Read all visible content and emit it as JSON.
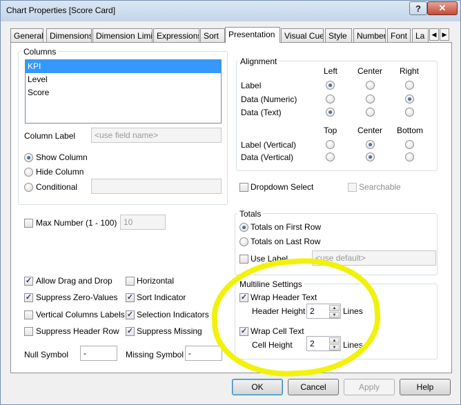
{
  "window": {
    "title": "Chart Properties [Score Card]",
    "help_button": "?",
    "close_button": "✕"
  },
  "tabs": [
    {
      "label": "General"
    },
    {
      "label": "Dimensions"
    },
    {
      "label": "Dimension Limits"
    },
    {
      "label": "Expressions"
    },
    {
      "label": "Sort"
    },
    {
      "label": "Presentation"
    },
    {
      "label": "Visual Cues"
    },
    {
      "label": "Style"
    },
    {
      "label": "Number"
    },
    {
      "label": "Font"
    },
    {
      "label": "La"
    }
  ],
  "active_tab": "Presentation",
  "columns": {
    "group_label": "Columns",
    "items": [
      {
        "label": "KPI",
        "selected": true
      },
      {
        "label": "Level",
        "selected": false
      },
      {
        "label": "Score",
        "selected": false
      }
    ],
    "column_label_text": "Column Label",
    "column_label_placeholder": "<use field name>",
    "show_column": "Show Column",
    "hide_column": "Hide Column",
    "conditional": "Conditional"
  },
  "alignment": {
    "group_label": "Alignment",
    "col_left": "Left",
    "col_center": "Center",
    "col_right": "Right",
    "row_label": "Label",
    "row_data_numeric": "Data (Numeric)",
    "row_data_text": "Data (Text)",
    "col_top": "Top",
    "col_center2": "Center",
    "col_bottom": "Bottom",
    "row_label_vertical": "Label (Vertical)",
    "row_data_vertical": "Data (Vertical)"
  },
  "dropdown_select": "Dropdown Select",
  "searchable": "Searchable",
  "max_number": {
    "label": "Max Number (1 - 100)",
    "value": "10"
  },
  "totals": {
    "group_label": "Totals",
    "first_row": "Totals on First Row",
    "last_row": "Totals on Last Row",
    "use_label": "Use Label",
    "use_label_placeholder": "<use default>"
  },
  "options": {
    "allow_drag_drop": "Allow Drag and Drop",
    "suppress_zero": "Suppress Zero-Values",
    "vertical_labels": "Vertical Columns Labels",
    "suppress_header": "Suppress Header Row",
    "horizontal": "Horizontal",
    "sort_indicator": "Sort Indicator",
    "selection_indicators": "Selection Indicators",
    "suppress_missing": "Suppress Missing"
  },
  "null_symbol": {
    "label": "Null Symbol",
    "value": "-"
  },
  "missing_symbol": {
    "label": "Missing Symbol",
    "value": "-"
  },
  "multiline": {
    "group_label": "Multiline Settings",
    "wrap_header": "Wrap Header Text",
    "header_height_label": "Header Height",
    "header_height": "2",
    "wrap_cell": "Wrap Cell Text",
    "cell_height_label": "Cell Height",
    "cell_height": "2",
    "lines": "Lines"
  },
  "buttons": {
    "ok": "OK",
    "cancel": "Cancel",
    "apply": "Apply",
    "help": "Help"
  },
  "check_glyph": "✓",
  "highlight_color": "#f1f20b"
}
